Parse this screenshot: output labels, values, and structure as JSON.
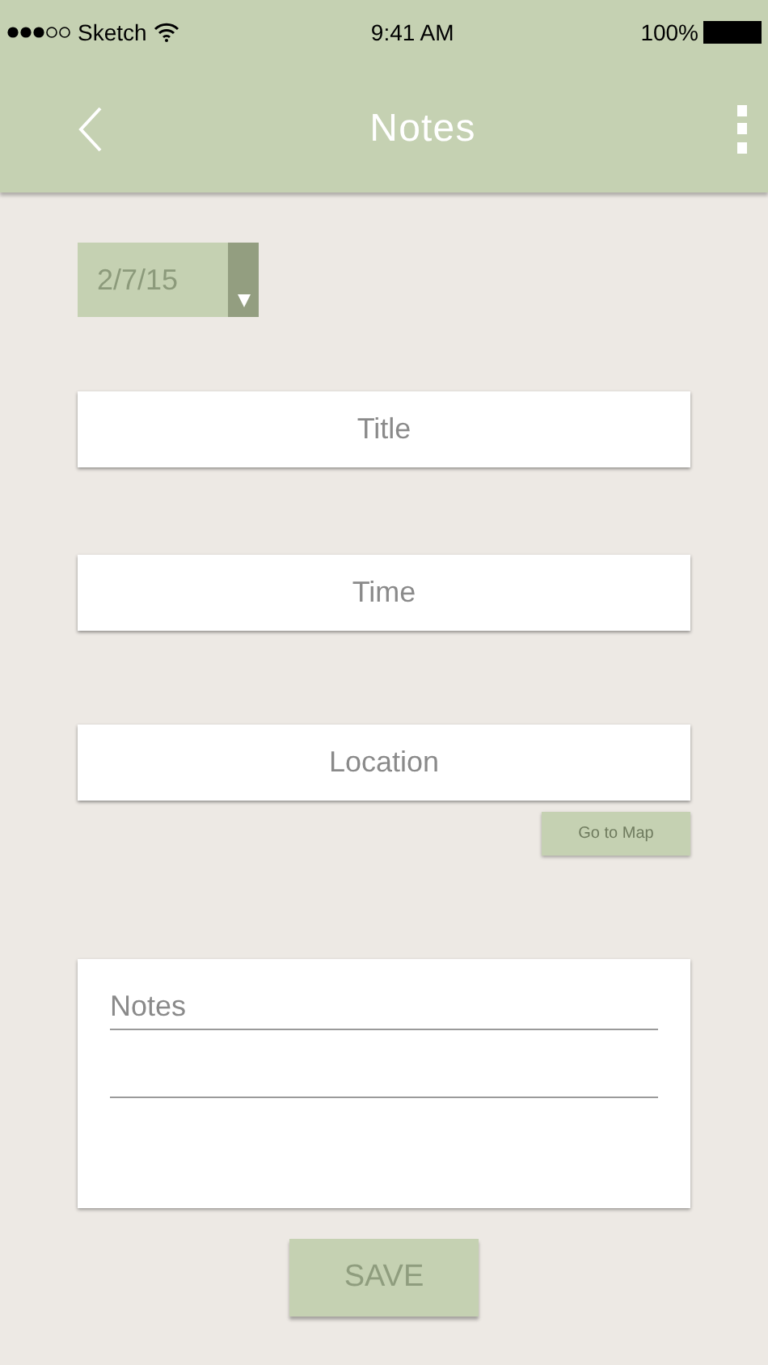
{
  "status_bar": {
    "carrier": "Sketch",
    "time": "9:41 AM",
    "battery": "100%"
  },
  "header": {
    "title": "Notes"
  },
  "date_picker": {
    "value": "2/7/15"
  },
  "fields": [
    {
      "placeholder": "Title"
    },
    {
      "placeholder": "Time"
    },
    {
      "placeholder": "Location"
    }
  ],
  "map_button": "Go to Map",
  "notes": {
    "placeholder": "Notes"
  },
  "save_button": "SAVE"
}
